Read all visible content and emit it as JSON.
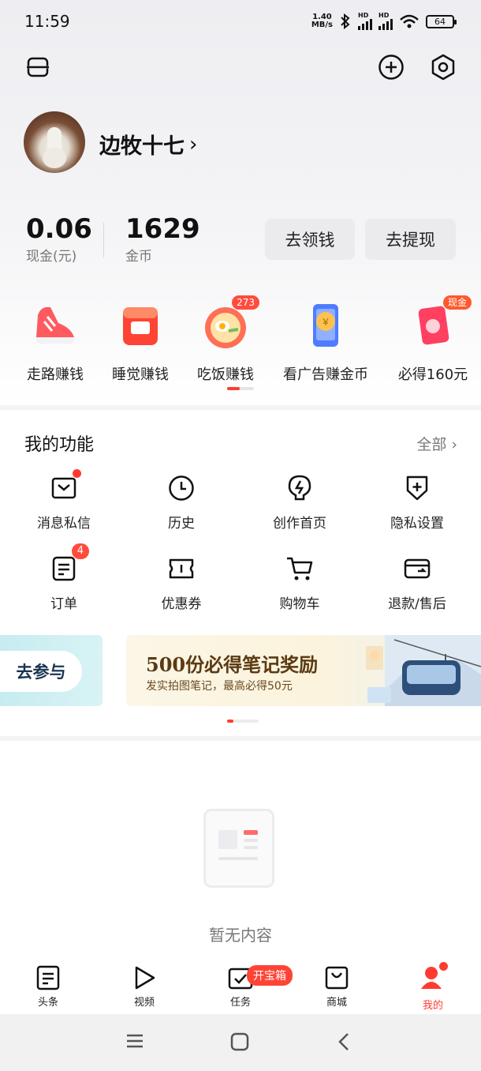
{
  "status_bar": {
    "time": "11:59",
    "net_speed_value": "1.40",
    "net_speed_unit": "MB/s",
    "signal_1_label": "HD",
    "signal_2_label": "HD",
    "battery": "64"
  },
  "header": {
    "menu_icon": "menu-lines-icon",
    "add_icon": "add-circle-icon",
    "settings_icon": "hexagon-settings-icon"
  },
  "profile": {
    "username": "边牧十七",
    "chevron": "›"
  },
  "stats": {
    "cash_value": "0.06",
    "cash_label": "现金(元)",
    "coin_value": "1629",
    "coin_label": "金币",
    "claim_button": "去领钱",
    "withdraw_button": "去提现"
  },
  "earn": {
    "items": [
      {
        "label": "走路赚钱",
        "icon": "sneaker-icon"
      },
      {
        "label": "睡觉赚钱",
        "icon": "alarm-clock-icon"
      },
      {
        "label": "吃饭赚钱",
        "icon": "food-bowl-icon",
        "badge": "273"
      },
      {
        "label": "看广告赚金币",
        "icon": "phone-coin-icon"
      },
      {
        "label": "必得160元",
        "icon": "red-envelope-icon",
        "badge": "现金"
      }
    ]
  },
  "functions": {
    "title": "我的功能",
    "all_label": "全部",
    "all_chevron": "›",
    "items": [
      {
        "label": "消息私信",
        "icon": "message-icon"
      },
      {
        "label": "历史",
        "icon": "clock-icon"
      },
      {
        "label": "创作首页",
        "icon": "lightning-bulb-icon"
      },
      {
        "label": "隐私设置",
        "icon": "shield-plus-icon"
      },
      {
        "label": "订单",
        "icon": "order-list-icon",
        "badge": "4"
      },
      {
        "label": "优惠券",
        "icon": "coupon-icon"
      },
      {
        "label": "购物车",
        "icon": "cart-icon"
      },
      {
        "label": "退款/售后",
        "icon": "refund-card-icon"
      }
    ]
  },
  "banners": {
    "join_label": "去参与",
    "promo_title": "500份必得笔记奖励",
    "promo_subtitle": "发实拍图笔记，最高必得50元"
  },
  "empty_state": {
    "text": "暂无内容"
  },
  "tabbar": {
    "tabs": [
      {
        "label": "头条",
        "icon": "headline-icon"
      },
      {
        "label": "视频",
        "icon": "play-icon"
      },
      {
        "label": "任务",
        "icon": "task-check-icon"
      },
      {
        "label": "商城",
        "icon": "shopping-bag-icon"
      },
      {
        "label": "我的",
        "icon": "profile-icon"
      }
    ],
    "task_badge": "开宝箱",
    "active_color": "#ff3b30"
  },
  "colors": {
    "accent_red": "#ff3b30",
    "promo_brown": "#5b3a13"
  }
}
